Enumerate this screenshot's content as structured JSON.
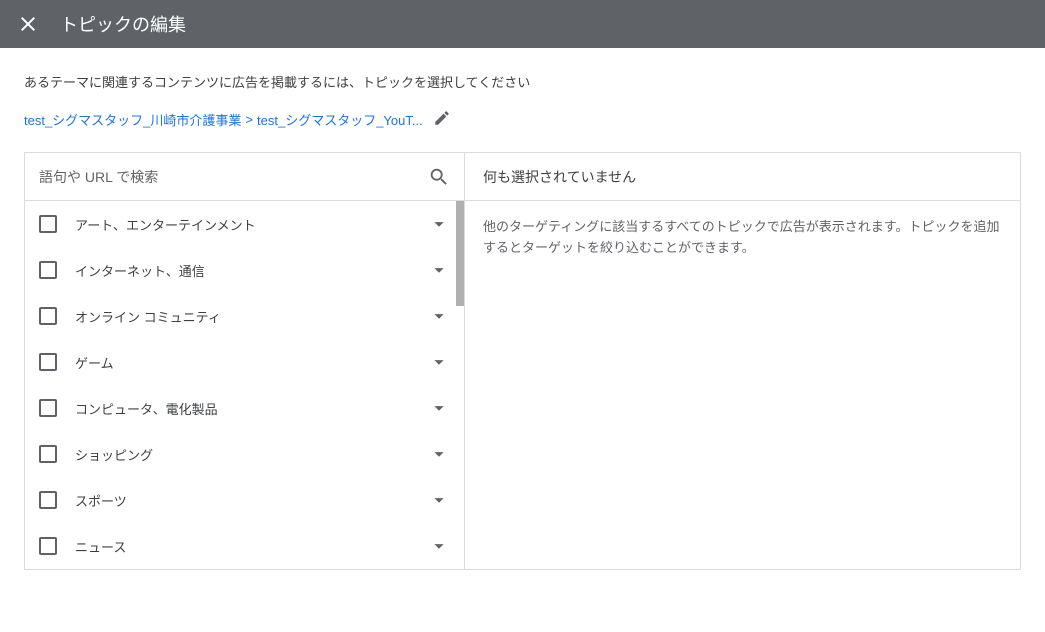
{
  "header": {
    "title": "トピックの編集"
  },
  "intro": "あるテーマに関連するコンテンツに広告を掲載するには、トピックを選択してください",
  "breadcrumb": {
    "first": "test_シグマスタッフ_川崎市介護事業",
    "second": "test_シグマスタッフ_YouT..."
  },
  "search": {
    "placeholder": "語句や URL で検索"
  },
  "topics": [
    {
      "label": "アート、エンターテインメント"
    },
    {
      "label": "インターネット、通信"
    },
    {
      "label": "オンライン コミュニティ"
    },
    {
      "label": "ゲーム"
    },
    {
      "label": "コンピュータ、電化製品"
    },
    {
      "label": "ショッピング"
    },
    {
      "label": "スポーツ"
    },
    {
      "label": "ニュース"
    }
  ],
  "right": {
    "header": "何も選択されていません",
    "body": "他のターゲティングに該当するすべてのトピックで広告が表示されます。トピックを追加するとターゲットを絞り込むことができます。"
  }
}
